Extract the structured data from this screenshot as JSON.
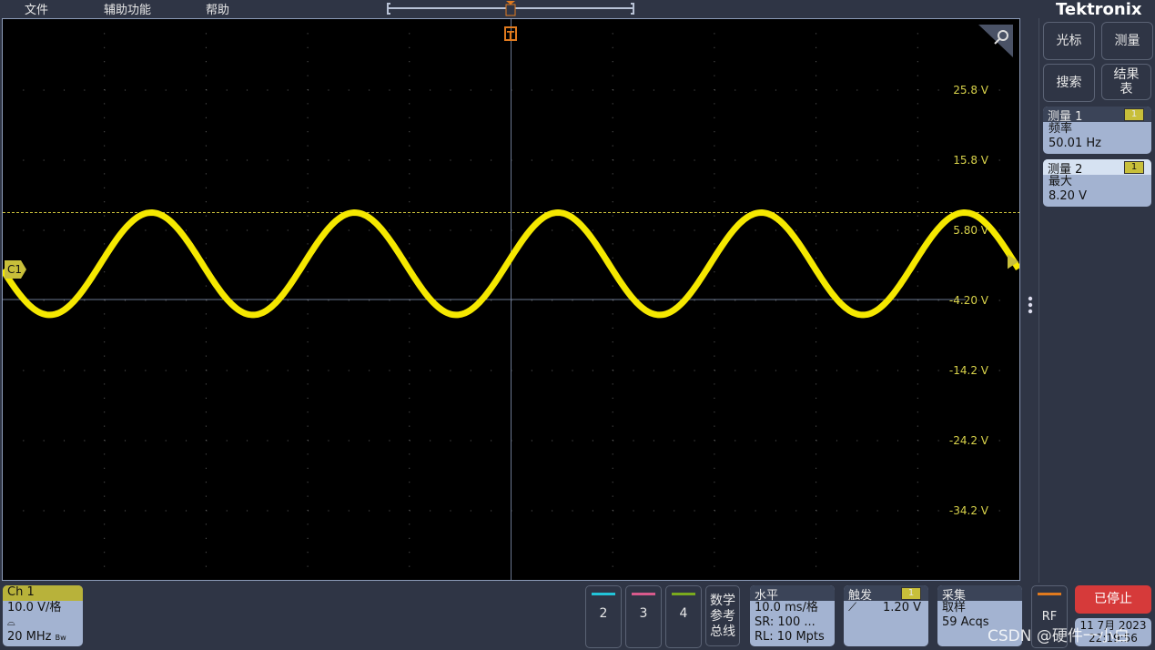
{
  "menu": {
    "file": "文件",
    "utility": "辅助功能",
    "help": "帮助"
  },
  "brand": "Tektronix",
  "side": {
    "cursor": "光标",
    "measure": "测量",
    "search": "搜索",
    "results": "结果表"
  },
  "measurements": [
    {
      "title": "测量 1",
      "source": "1",
      "type": "频率",
      "value": "50.01 Hz"
    },
    {
      "title": "测量 2",
      "source": "1",
      "type": "最大",
      "value": "8.20 V"
    }
  ],
  "plot": {
    "trigger_marker": "T",
    "channel_marker": "C1",
    "y_labels": [
      "25.8 V",
      "15.8 V",
      "5.80 V",
      "-4.20 V",
      "-14.2 V",
      "-24.2 V",
      "-34.2 V"
    ],
    "trace_color": "#f5e800"
  },
  "chart_data": {
    "type": "line",
    "signal": "sine",
    "frequency_hz": 50.01,
    "max_v": 8.2,
    "min_v": -6.4,
    "volts_per_div": 10,
    "time_per_div_ms": 10,
    "y_ticks": [
      25.8,
      15.8,
      5.8,
      -4.2,
      -14.2,
      -24.2,
      -34.2
    ],
    "trigger_level_v": 1.2
  },
  "ch1": {
    "title": "Ch 1",
    "scale": "10.0 V/格",
    "bandwidth": "20 MHz",
    "bw_suffix": "Bw"
  },
  "channels": [
    {
      "label": "2",
      "color": "#22c4d8"
    },
    {
      "label": "3",
      "color": "#d85a8c"
    },
    {
      "label": "4",
      "color": "#7aaa1e"
    }
  ],
  "math": [
    "数学",
    "参考",
    "总线"
  ],
  "horizontal": {
    "title": "水平",
    "scale": "10.0 ms/格",
    "sr": "SR: 100 ...",
    "rl": "RL: 10 Mpts"
  },
  "trigger": {
    "title": "触发",
    "source": "1",
    "level": "1.20 V"
  },
  "acquire": {
    "title": "采集",
    "mode": "取样",
    "count": "59 Acqs"
  },
  "rf": "RF",
  "status": "已停止",
  "date": "11 7月 2023",
  "time": "22:19:56",
  "watermark": "CSDN @硬件一小白"
}
